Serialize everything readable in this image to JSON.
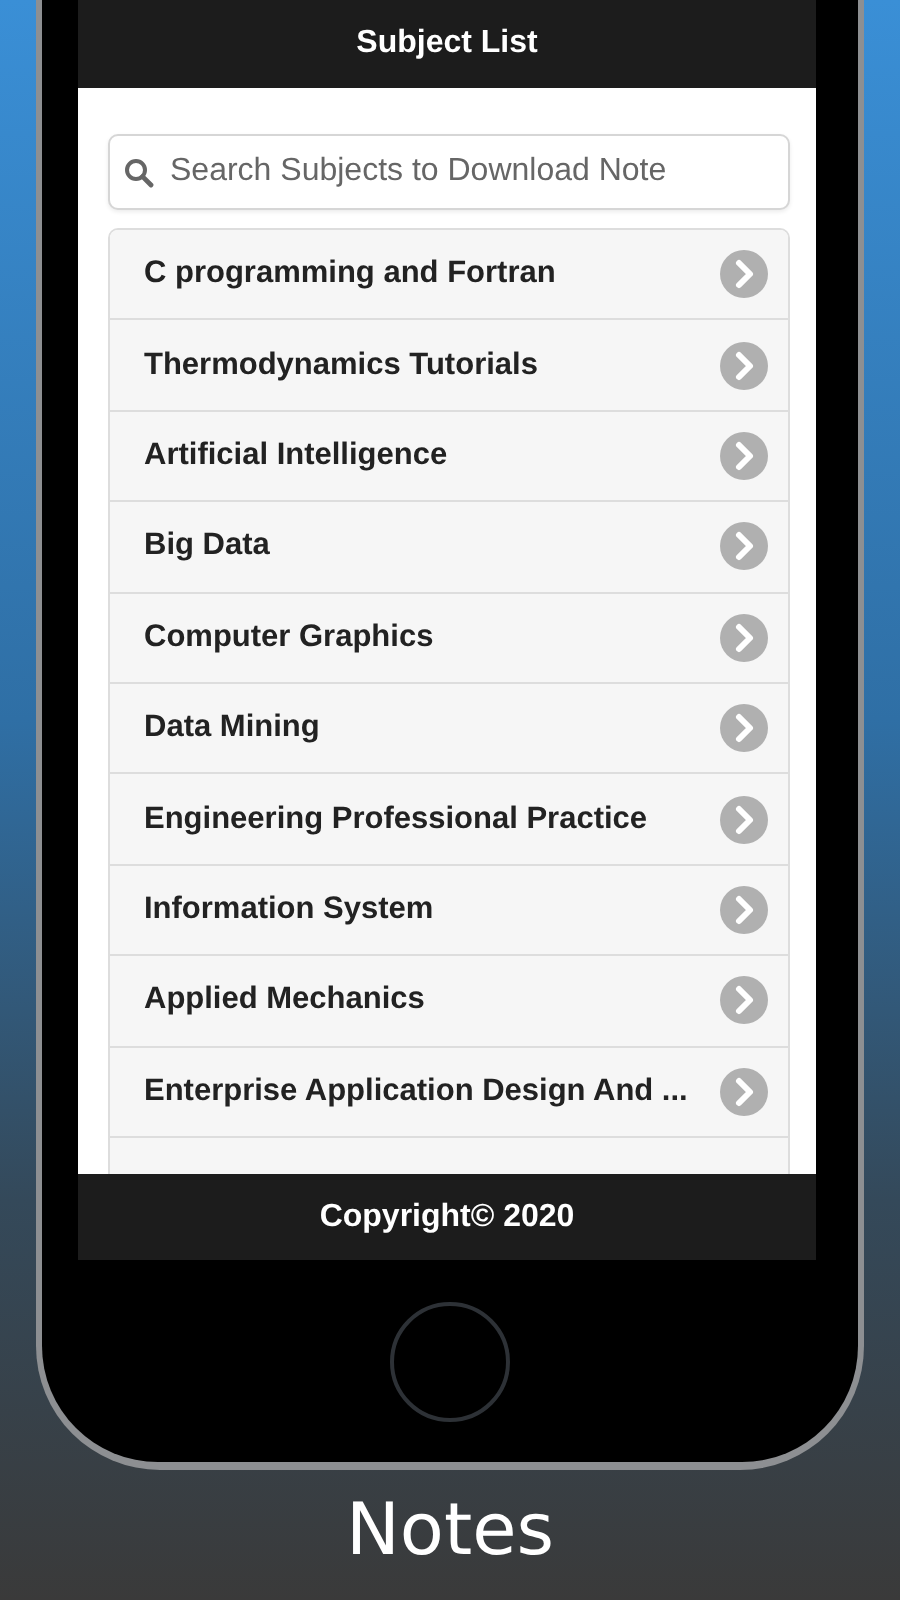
{
  "header": {
    "title": "Subject List"
  },
  "search": {
    "placeholder": "Search Subjects to Download Note"
  },
  "subjects": [
    {
      "name": "C programming and Fortran"
    },
    {
      "name": "Thermodynamics Tutorials"
    },
    {
      "name": "Artificial Intelligence"
    },
    {
      "name": "Big Data"
    },
    {
      "name": "Computer Graphics"
    },
    {
      "name": "Data Mining"
    },
    {
      "name": "Engineering Professional Practice"
    },
    {
      "name": "Information System"
    },
    {
      "name": "Applied Mechanics"
    },
    {
      "name": "Enterprise Application Design And ..."
    }
  ],
  "footer": {
    "text": "Copyright© 2020"
  },
  "caption": "Notes"
}
